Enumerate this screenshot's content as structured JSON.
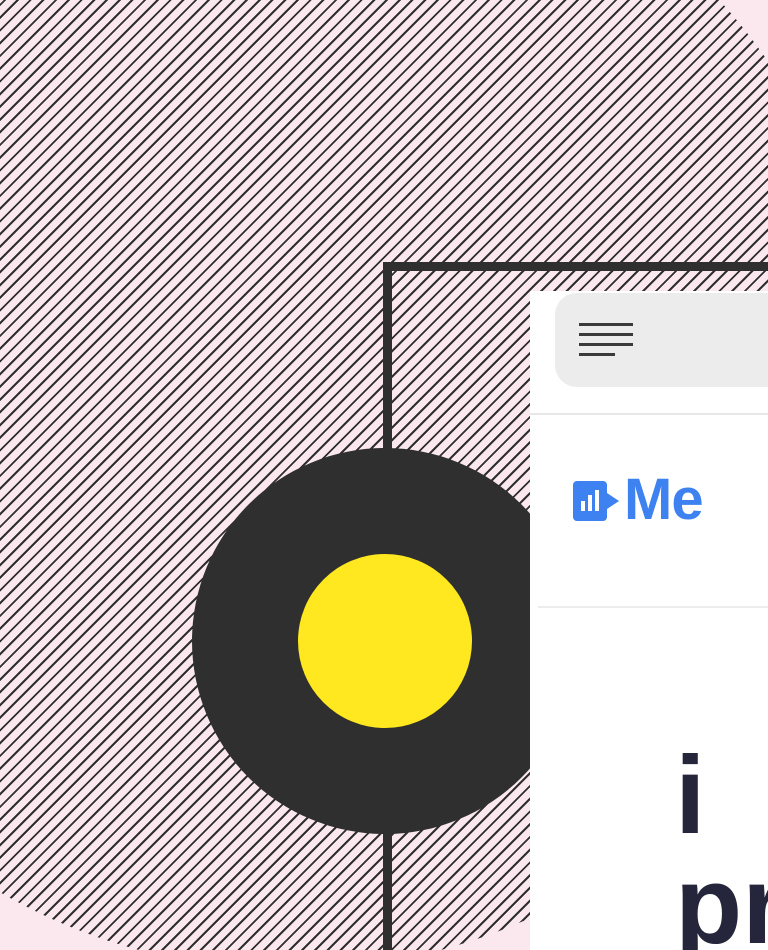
{
  "brand": {
    "name": "Me",
    "color": "#3d82f0",
    "logo_icon": "bar-chart-logo-icon"
  },
  "toolbar": {
    "menu_icon": "menu-icon"
  },
  "headline": {
    "text": "i\npr"
  },
  "colors": {
    "background": "#fbe7ee",
    "dark": "#2f2f2f",
    "accent": "#ffe81f"
  }
}
